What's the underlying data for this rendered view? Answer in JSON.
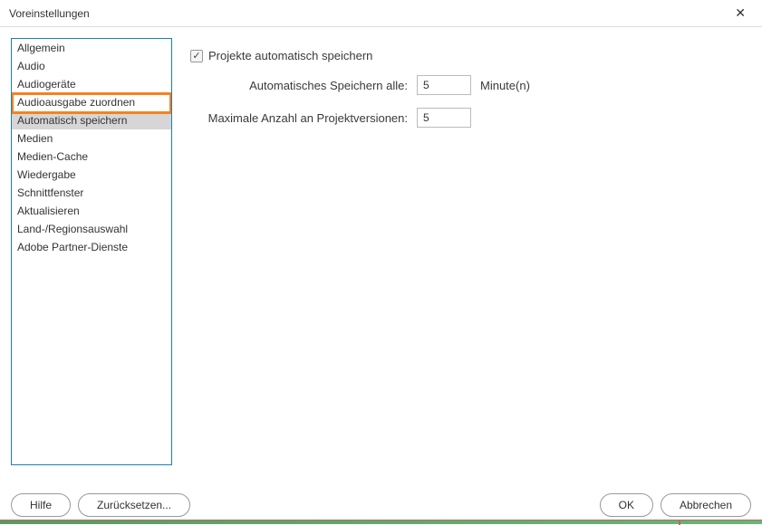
{
  "window": {
    "title": "Voreinstellungen"
  },
  "sidebar": {
    "items": [
      {
        "label": "Allgemein"
      },
      {
        "label": "Audio"
      },
      {
        "label": "Audiogeräte"
      },
      {
        "label": "Audioausgabe zuordnen"
      },
      {
        "label": "Automatisch speichern"
      },
      {
        "label": "Medien"
      },
      {
        "label": "Medien-Cache"
      },
      {
        "label": "Wiedergabe"
      },
      {
        "label": "Schnittfenster"
      },
      {
        "label": "Aktualisieren"
      },
      {
        "label": "Land-/Regionsauswahl"
      },
      {
        "label": "Adobe Partner-Dienste"
      }
    ],
    "highlighted_index": 3,
    "selected_index": 4
  },
  "content": {
    "autosave_checkbox_label": "Projekte automatisch speichern",
    "autosave_checked": true,
    "interval_label": "Automatisches Speichern alle:",
    "interval_value": "5",
    "interval_unit": "Minute(n)",
    "max_versions_label": "Maximale Anzahl an Projektversionen:",
    "max_versions_value": "5"
  },
  "footer": {
    "help_label": "Hilfe",
    "reset_label": "Zurücksetzen...",
    "ok_label": "OK",
    "cancel_label": "Abbrechen"
  }
}
